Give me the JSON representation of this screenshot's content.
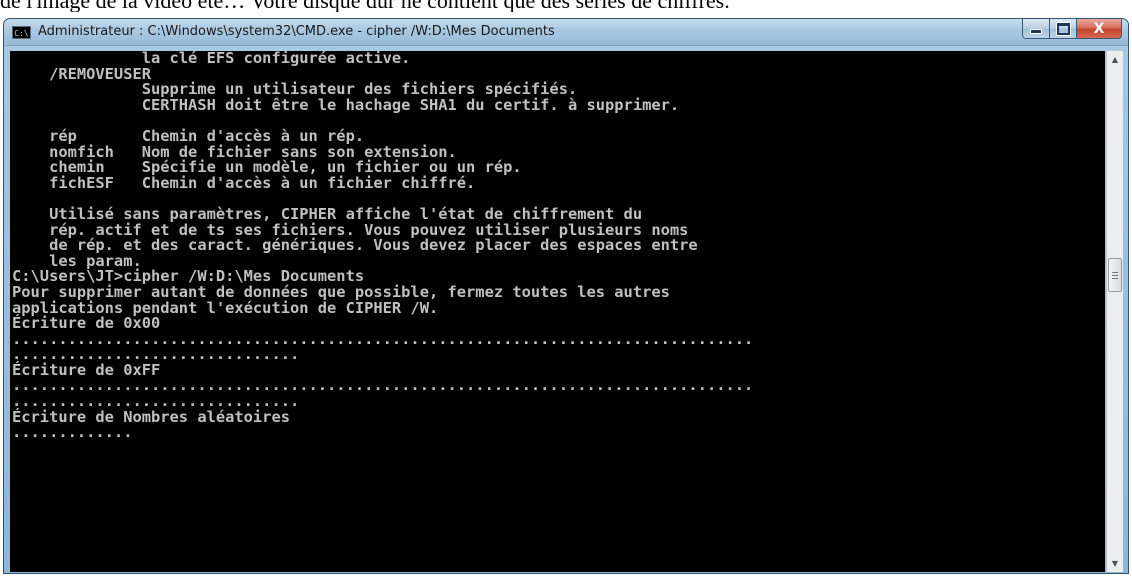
{
  "background_text": "de l'image de la vidéo été… Votre disque dur ne contient que des séries de chiffres.",
  "window": {
    "title": "Administrateur : C:\\Windows\\system32\\CMD.exe - cipher  /W:D:\\Mes Documents",
    "icon_label": "C:\\",
    "icon": "cmd-icon"
  },
  "caption_buttons": {
    "minimize": "minimize-icon",
    "maximize": "maximize-icon",
    "close": "close-icon",
    "close_glyph": "X"
  },
  "console": {
    "text_color": "#c0c0c0",
    "background_color": "#000000",
    "lines": [
      "              la clé EFS configurée active.",
      "    /REMOVEUSER",
      "              Supprime un utilisateur des fichiers spécifiés.",
      "              CERTHASH doit être le hachage SHA1 du certif. à supprimer.",
      "",
      "    rép       Chemin d'accès à un rép.",
      "    nomfich   Nom de fichier sans son extension.",
      "    chemin    Spécifie un modèle, un fichier ou un rép.",
      "    fichESF   Chemin d'accès à un fichier chiffré.",
      "",
      "    Utilisé sans paramètres, CIPHER affiche l'état de chiffrement du",
      "    rép. actif et de ts ses fichiers. Vous pouvez utiliser plusieurs noms",
      "    de rép. et des caract. génériques. Vous devez placer des espaces entre",
      "    les param.",
      "C:\\Users\\JT>cipher /W:D:\\Mes Documents",
      "Pour supprimer autant de données que possible, fermez toutes les autres",
      "applications pendant l'exécution de CIPHER /W.",
      "Écriture de 0x00",
      "................................................................................",
      "...............................",
      "Écriture de 0xFF",
      "................................................................................",
      "...............................",
      "Écriture de Nombres aléatoires",
      "............."
    ]
  },
  "scrollbar": {
    "up_arrow": "▲",
    "down_arrow": "▼",
    "position_fraction": 0.42
  }
}
